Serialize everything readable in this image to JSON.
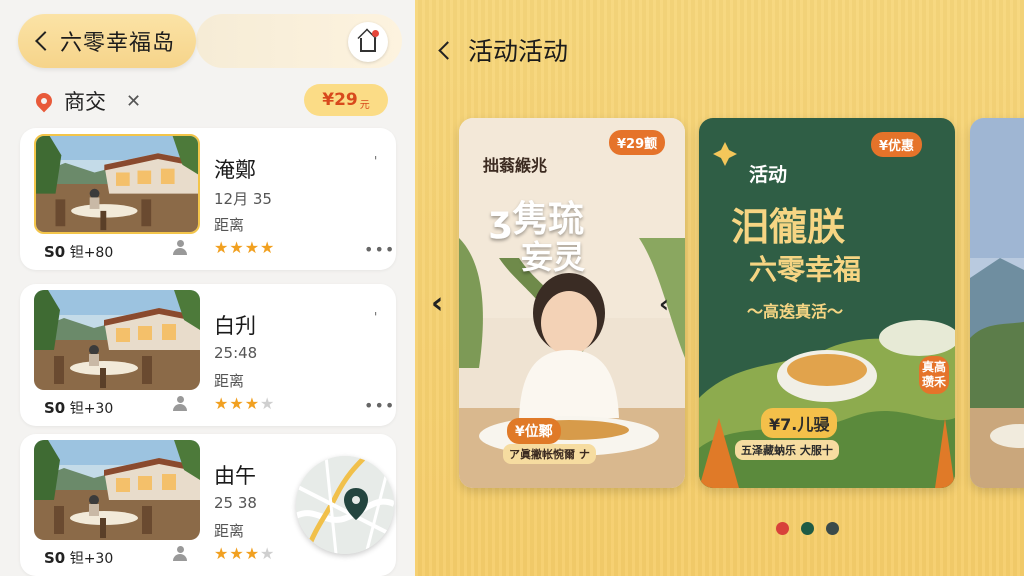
{
  "left": {
    "title": "六零幸福岛",
    "location": "商交",
    "location_close": "✕",
    "price": "¥29",
    "price_unit": "元",
    "cards": [
      {
        "name": "淹鄭",
        "date": "12月 35",
        "dist": "距离",
        "meta_prefix": "S0",
        "meta": " 钽+80",
        "stars": 4,
        "more": "•••",
        "tick": "'"
      },
      {
        "name": "白刋",
        "date": "25:48",
        "dist": "距离",
        "meta_prefix": "S0",
        "meta": " 钽+30",
        "stars": 3,
        "more": "•••",
        "tick": "'"
      },
      {
        "name": "由午",
        "date": "25 38",
        "dist": "距离",
        "meta_prefix": "S0",
        "meta": " 钽+30",
        "stars": 3
      }
    ]
  },
  "right": {
    "title": "活动活动",
    "poster1": {
      "tag": "¥29颤",
      "line1": "拙蓊緱兆",
      "line2": "ʒ隽琉",
      "line3": "妄灵",
      "plate_tag": "¥位鄹",
      "plate_text": "ア眞撇帐惋爾 ナ"
    },
    "poster2": {
      "tag": "¥优惠",
      "line1": "活动",
      "line2": "汨徿朕",
      "line3": "六零幸福",
      "line4": "～高逘真活～",
      "price": "¥7.儿骎",
      "bottom": "五泽藏蚋乐 大服十",
      "side": "真高瓒禾"
    },
    "carousel_dots": [
      "#d8413a",
      "#1f5b45",
      "#3a4a4a"
    ],
    "colors": {
      "accent": "#e5732a",
      "dark_green": "#2f5e45"
    }
  }
}
